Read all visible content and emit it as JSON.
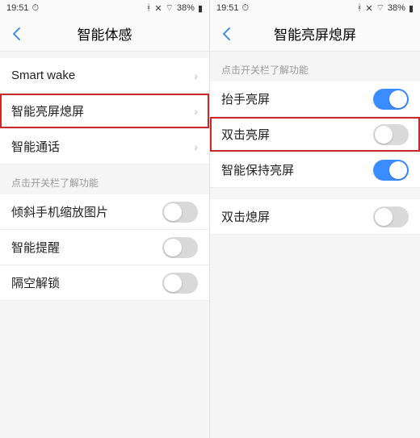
{
  "status": {
    "time": "19:51",
    "battery": "38%",
    "icons": [
      "bt",
      "mute",
      "wifi"
    ]
  },
  "left": {
    "title": "智能体感",
    "items": [
      {
        "label": "Smart wake",
        "type": "link"
      },
      {
        "label": "智能亮屏熄屏",
        "type": "link",
        "highlighted": true
      },
      {
        "label": "智能通话",
        "type": "link"
      }
    ],
    "section_header": "点击开关栏了解功能",
    "toggles": [
      {
        "label": "倾斜手机缩放图片",
        "on": false
      },
      {
        "label": "智能提醒",
        "on": false
      },
      {
        "label": "隔空解锁",
        "on": false
      }
    ]
  },
  "right": {
    "title": "智能亮屏熄屏",
    "section_header": "点击开关栏了解功能",
    "group1": [
      {
        "label": "抬手亮屏",
        "on": true
      },
      {
        "label": "双击亮屏",
        "on": false,
        "highlighted": true
      },
      {
        "label": "智能保持亮屏",
        "on": true
      }
    ],
    "group2": [
      {
        "label": "双击熄屏",
        "on": false
      }
    ]
  }
}
